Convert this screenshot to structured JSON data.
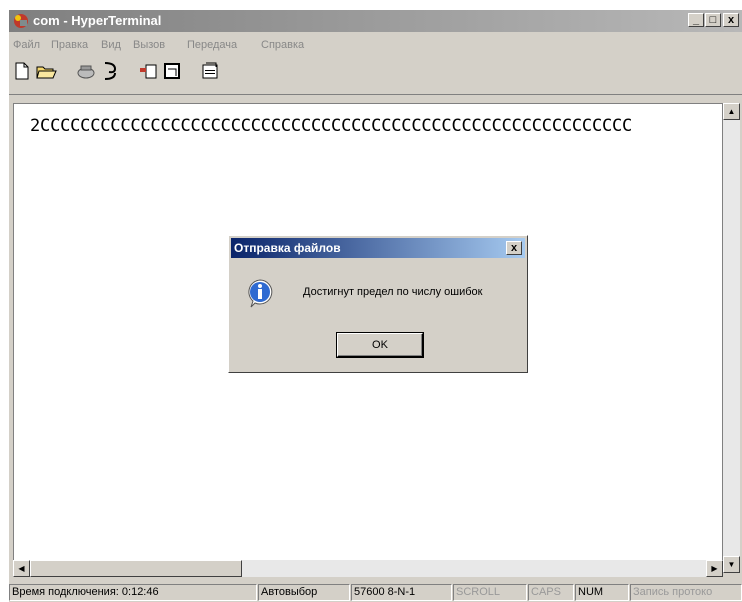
{
  "window": {
    "title": "com - HyperTerminal",
    "controls": {
      "minimize": "_",
      "maximize": "□",
      "close": "x"
    }
  },
  "menu": [
    "Файл",
    "Правка",
    "Вид",
    "Вызов",
    "Передача",
    "Справка"
  ],
  "toolbar": {
    "icons": [
      "new-file-icon",
      "open-folder-icon",
      "phone-icon",
      "disconnect-icon",
      "send-icon",
      "receive-icon",
      "properties-icon"
    ]
  },
  "terminal": {
    "text": "2CCCCCCCCCCCCCCCCCCCCCCCCCCCCCCCCCCCCCCCCCCCCCCCCCCCCCCCCCCC"
  },
  "dialog": {
    "title": "Отправка файлов",
    "close": "x",
    "message": "Достигнут предел по числу ошибок",
    "ok_label": "OK",
    "icon": "info-icon"
  },
  "status": {
    "connected": "Время подключения: 0:12:46",
    "detect": "Автовыбор",
    "params": "57600 8-N-1",
    "scroll": "SCROLL",
    "caps": "CAPS",
    "num": "NUM",
    "capture": "Запись протоко"
  },
  "colors": {
    "dialog_title": "#0a246a",
    "window_title_inactive": "#7f7f7f",
    "face": "#d4d0c8"
  }
}
